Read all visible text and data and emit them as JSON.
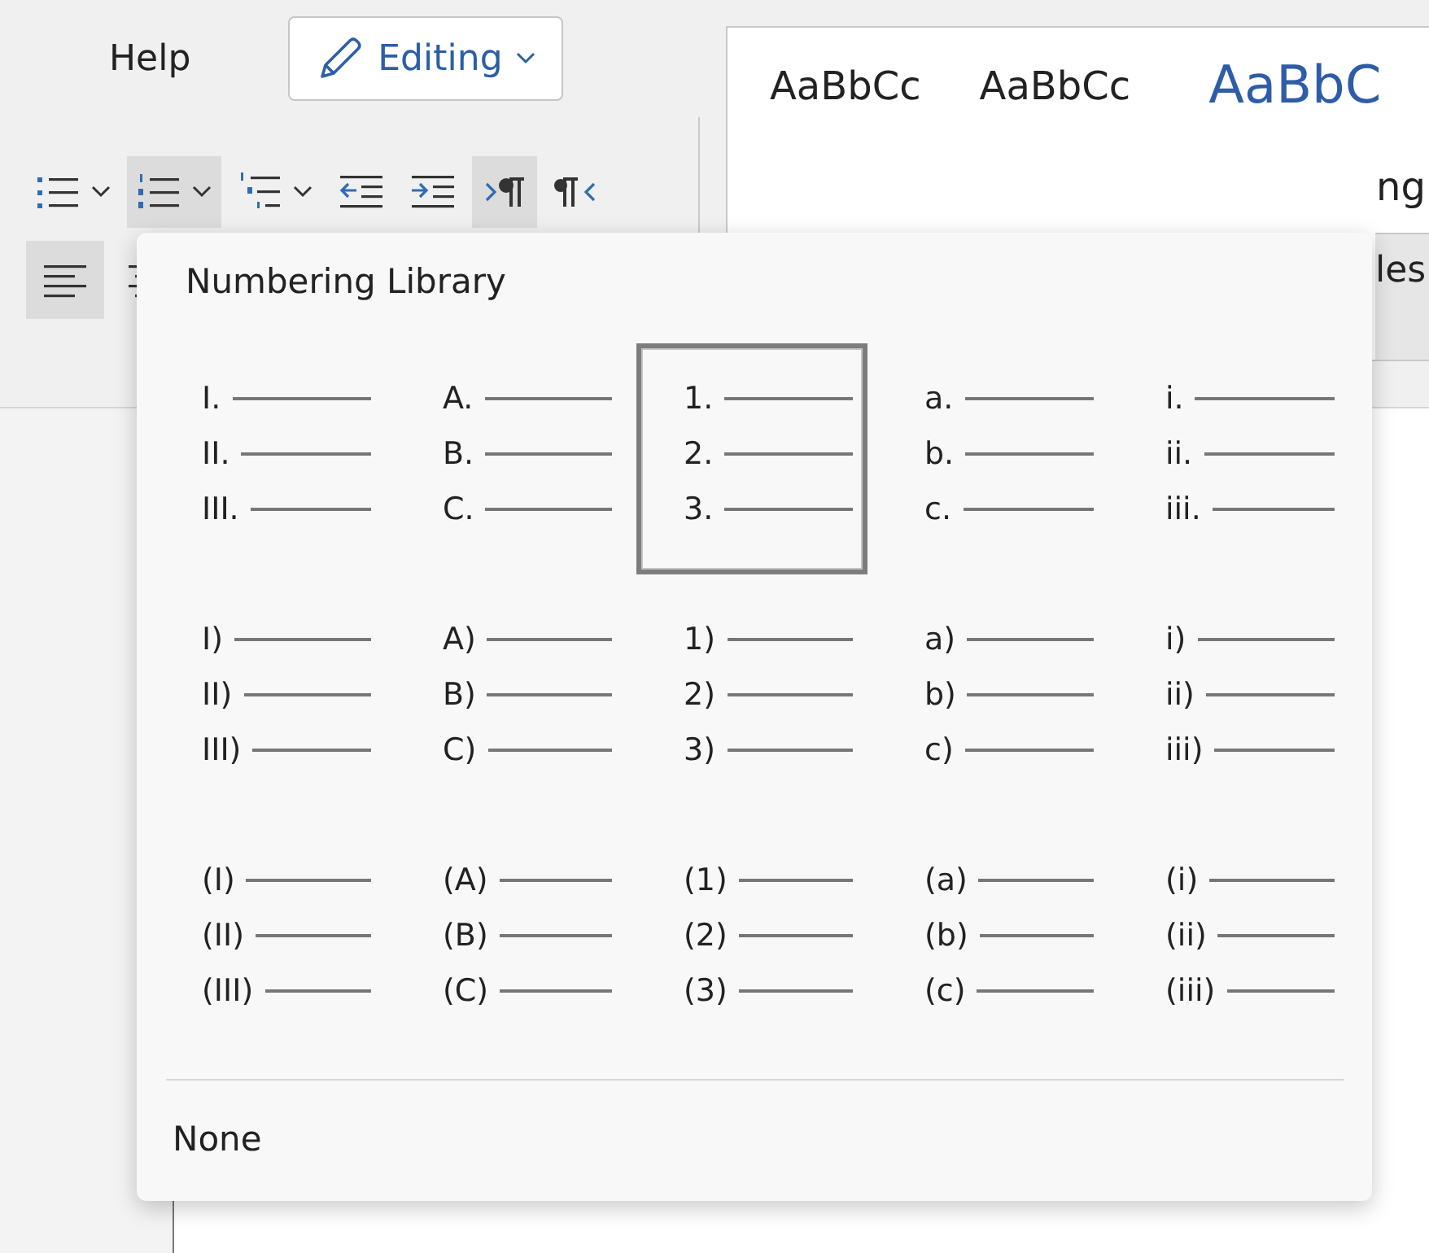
{
  "ribbon": {
    "tab": "Help",
    "editing_button": {
      "label": "Editing"
    },
    "toolbar_row_1": [
      {
        "kind": "bullets",
        "pressed": false
      },
      {
        "kind": "numbering",
        "pressed": true
      },
      {
        "kind": "multilevel",
        "pressed": false
      },
      {
        "kind": "decrease-indent",
        "pressed": false
      },
      {
        "kind": "increase-indent",
        "pressed": false
      },
      {
        "kind": "ltr",
        "pressed": true
      },
      {
        "kind": "rtl",
        "pressed": false
      }
    ],
    "toolbar_row_2": [
      {
        "kind": "align-left",
        "pressed": true
      },
      {
        "kind": "align-center",
        "pressed": false
      }
    ],
    "styles": {
      "samples": [
        {
          "text": "AaBbCc",
          "kind": "body"
        },
        {
          "text": "AaBbCc",
          "kind": "body"
        },
        {
          "text": "AaBbC",
          "kind": "heading"
        }
      ],
      "cut_label": "ng",
      "styles_button": "les"
    }
  },
  "numbering_library": {
    "title": "Numbering Library",
    "formats": [
      {
        "markers": [
          "I.",
          "II.",
          "III."
        ],
        "selected": false
      },
      {
        "markers": [
          "A.",
          "B.",
          "C."
        ],
        "selected": false
      },
      {
        "markers": [
          "1.",
          "2.",
          "3."
        ],
        "selected": true
      },
      {
        "markers": [
          "a.",
          "b.",
          "c."
        ],
        "selected": false
      },
      {
        "markers": [
          "i.",
          "ii.",
          "iii."
        ],
        "selected": false
      },
      {
        "markers": [
          "I)",
          "II)",
          "III)"
        ],
        "selected": false
      },
      {
        "markers": [
          "A)",
          "B)",
          "C)"
        ],
        "selected": false
      },
      {
        "markers": [
          "1)",
          "2)",
          "3)"
        ],
        "selected": false
      },
      {
        "markers": [
          "a)",
          "b)",
          "c)"
        ],
        "selected": false
      },
      {
        "markers": [
          "i)",
          "ii)",
          "iii)"
        ],
        "selected": false
      },
      {
        "markers": [
          "(I)",
          "(II)",
          "(III)"
        ],
        "selected": false
      },
      {
        "markers": [
          "(A)",
          "(B)",
          "(C)"
        ],
        "selected": false
      },
      {
        "markers": [
          "(1)",
          "(2)",
          "(3)"
        ],
        "selected": false
      },
      {
        "markers": [
          "(a)",
          "(b)",
          "(c)"
        ],
        "selected": false
      },
      {
        "markers": [
          "(i)",
          "(ii)",
          "(iii)"
        ],
        "selected": false
      }
    ],
    "none_option": "None"
  }
}
